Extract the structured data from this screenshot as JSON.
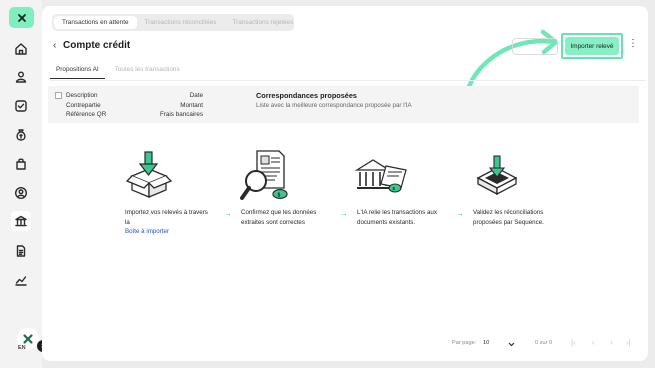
{
  "sidebar": {
    "items": [
      {
        "name": "home-icon"
      },
      {
        "name": "user-icon"
      },
      {
        "name": "checkbox-icon"
      },
      {
        "name": "money-bag-icon"
      },
      {
        "name": "shopping-bag-icon"
      },
      {
        "name": "profile-circle-icon"
      },
      {
        "name": "bank-icon",
        "active": true
      },
      {
        "name": "document-icon"
      },
      {
        "name": "chart-icon"
      }
    ],
    "avatar_badge": "3",
    "language": "EN"
  },
  "top_tabs": [
    "Transactions en attente",
    "Transactions réconciliées",
    "Transactions rejetées"
  ],
  "page": {
    "title": "Compte crédit",
    "import_button": "Importer relevé",
    "more": "⋮"
  },
  "sub_tabs": [
    "Propositions AI",
    "Toutes les transactions"
  ],
  "table_header": {
    "left": [
      "Description",
      "Contrepartie",
      "Référence QR"
    ],
    "right": [
      "Date",
      "Montant",
      "Frais bancaires"
    ],
    "correspondences_title": "Correspondances proposées",
    "correspondences_subtitle": "Liste avec la meilleure correspondance proposée par l'IA"
  },
  "steps": [
    {
      "line1": "Importez vos relevés à travers",
      "line2": "la",
      "link": "Boîte à importer"
    },
    {
      "line1": "Confirmez que les données",
      "line2": "extraites sont correctes"
    },
    {
      "line1": "L'IA relie les transactions aux",
      "line2": "documents existants."
    },
    {
      "line1": "Validez les réconciliations",
      "line2": "proposées par Sequence."
    }
  ],
  "step_arrow": "→",
  "pagination": {
    "per_page_label": "Par page:",
    "per_page_value": "10",
    "range": "0 sur 0",
    "first": "|‹",
    "prev": "‹",
    "next": "›",
    "last": "›|"
  },
  "colors": {
    "accent": "#86efc5",
    "accent_border": "#62e6b0",
    "link": "#2552c4"
  }
}
